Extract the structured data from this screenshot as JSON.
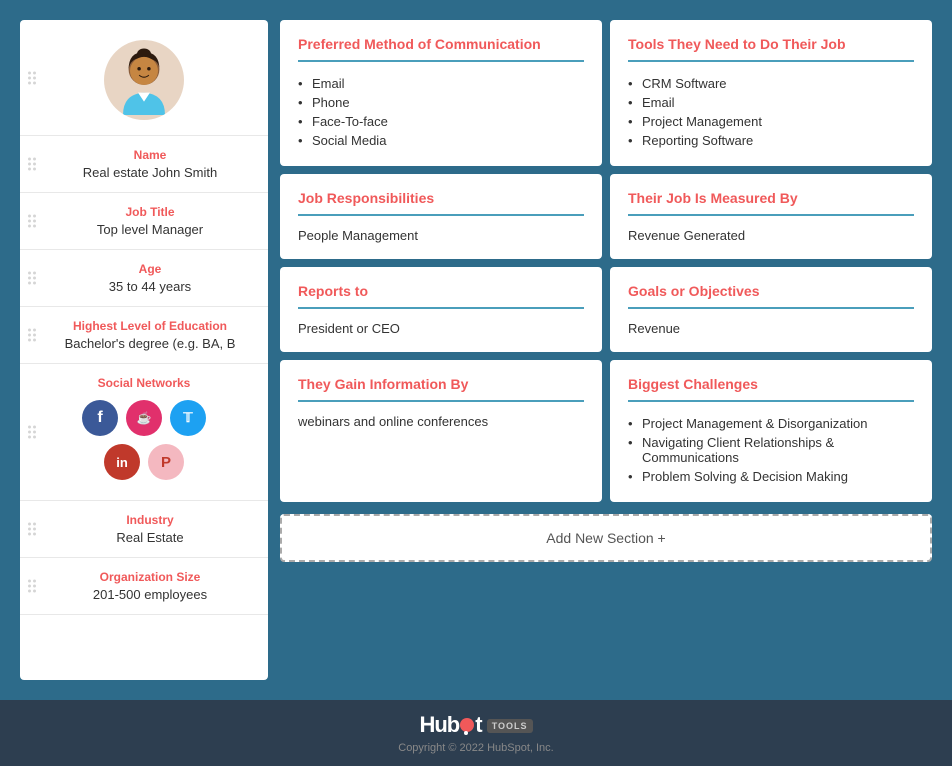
{
  "sidebar": {
    "avatar_alt": "persona avatar",
    "name_label": "Name",
    "name_value": "Real estate John Smith",
    "job_label": "Job Title",
    "job_value": "Top level Manager",
    "age_label": "Age",
    "age_value": "35 to 44 years",
    "education_label": "Highest Level of Education",
    "education_value": "Bachelor's degree (e.g. BA, B",
    "social_label": "Social Networks",
    "social_icons": [
      "f",
      "ig",
      "tw",
      "in",
      "pi"
    ],
    "industry_label": "Industry",
    "industry_value": "Real Estate",
    "org_label": "Organization Size",
    "org_value": "201-500 employees"
  },
  "cards": [
    {
      "id": "preferred-communication",
      "title": "Preferred Method of Communication",
      "type": "list",
      "items": [
        "Email",
        "Phone",
        "Face-To-face",
        "Social Media"
      ]
    },
    {
      "id": "tools-needed",
      "title": "Tools They Need to Do Their Job",
      "type": "list",
      "items": [
        "CRM Software",
        "Email",
        "Project Management",
        "Reporting Software"
      ]
    },
    {
      "id": "job-responsibilities",
      "title": "Job Responsibilities",
      "type": "text",
      "content": "People Management"
    },
    {
      "id": "job-measured-by",
      "title": "Their Job Is Measured By",
      "type": "text",
      "content": "Revenue Generated"
    },
    {
      "id": "reports-to",
      "title": "Reports to",
      "type": "text",
      "content": "President or CEO"
    },
    {
      "id": "goals-objectives",
      "title": "Goals or Objectives",
      "type": "text",
      "content": "Revenue"
    },
    {
      "id": "gain-information",
      "title": "They Gain Information By",
      "type": "text",
      "content": "webinars and online conferences"
    },
    {
      "id": "biggest-challenges",
      "title": "Biggest Challenges",
      "type": "list",
      "items": [
        "Project Management & Disorganization",
        "Navigating Client Relationships & Communications",
        "Problem Solving & Decision Making"
      ]
    }
  ],
  "add_section_label": "Add New Section +",
  "footer": {
    "logo_text": "HubSpot",
    "tools_badge": "TOOLS",
    "copyright": "Copyright © 2022 HubSpot, Inc."
  }
}
